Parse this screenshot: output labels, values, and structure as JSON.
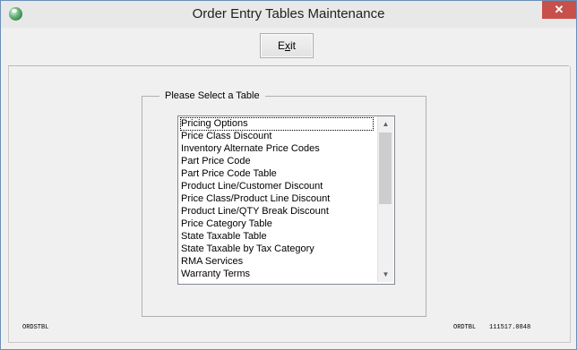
{
  "window": {
    "title": "Order Entry Tables Maintenance",
    "close_glyph": "✕"
  },
  "toolbar": {
    "exit_label": "Exit"
  },
  "group": {
    "legend": "Please Select a Table"
  },
  "list": {
    "items": [
      {
        "label": "Pricing Options",
        "selected": true
      },
      {
        "label": "Price Class Discount"
      },
      {
        "label": "Inventory Alternate Price Codes"
      },
      {
        "label": "Part Price Code"
      },
      {
        "label": "Part Price Code Table"
      },
      {
        "label": "Product Line/Customer Discount"
      },
      {
        "label": "Price Class/Product Line Discount"
      },
      {
        "label": "Product Line/QTY Break Discount"
      },
      {
        "label": "Price Category Table"
      },
      {
        "label": "State Taxable Table"
      },
      {
        "label": "State Taxable by Tax Category"
      },
      {
        "label": "RMA Services"
      },
      {
        "label": "Warranty Terms"
      }
    ],
    "scroll_up_glyph": "▲",
    "scroll_down_glyph": "▼"
  },
  "footer": {
    "left_code": "ORDSTBL",
    "right_code": "ORDTBL",
    "version": "111517.0848"
  },
  "colors": {
    "close_button": "#c7504b",
    "window_border": "#6a8fb8"
  }
}
